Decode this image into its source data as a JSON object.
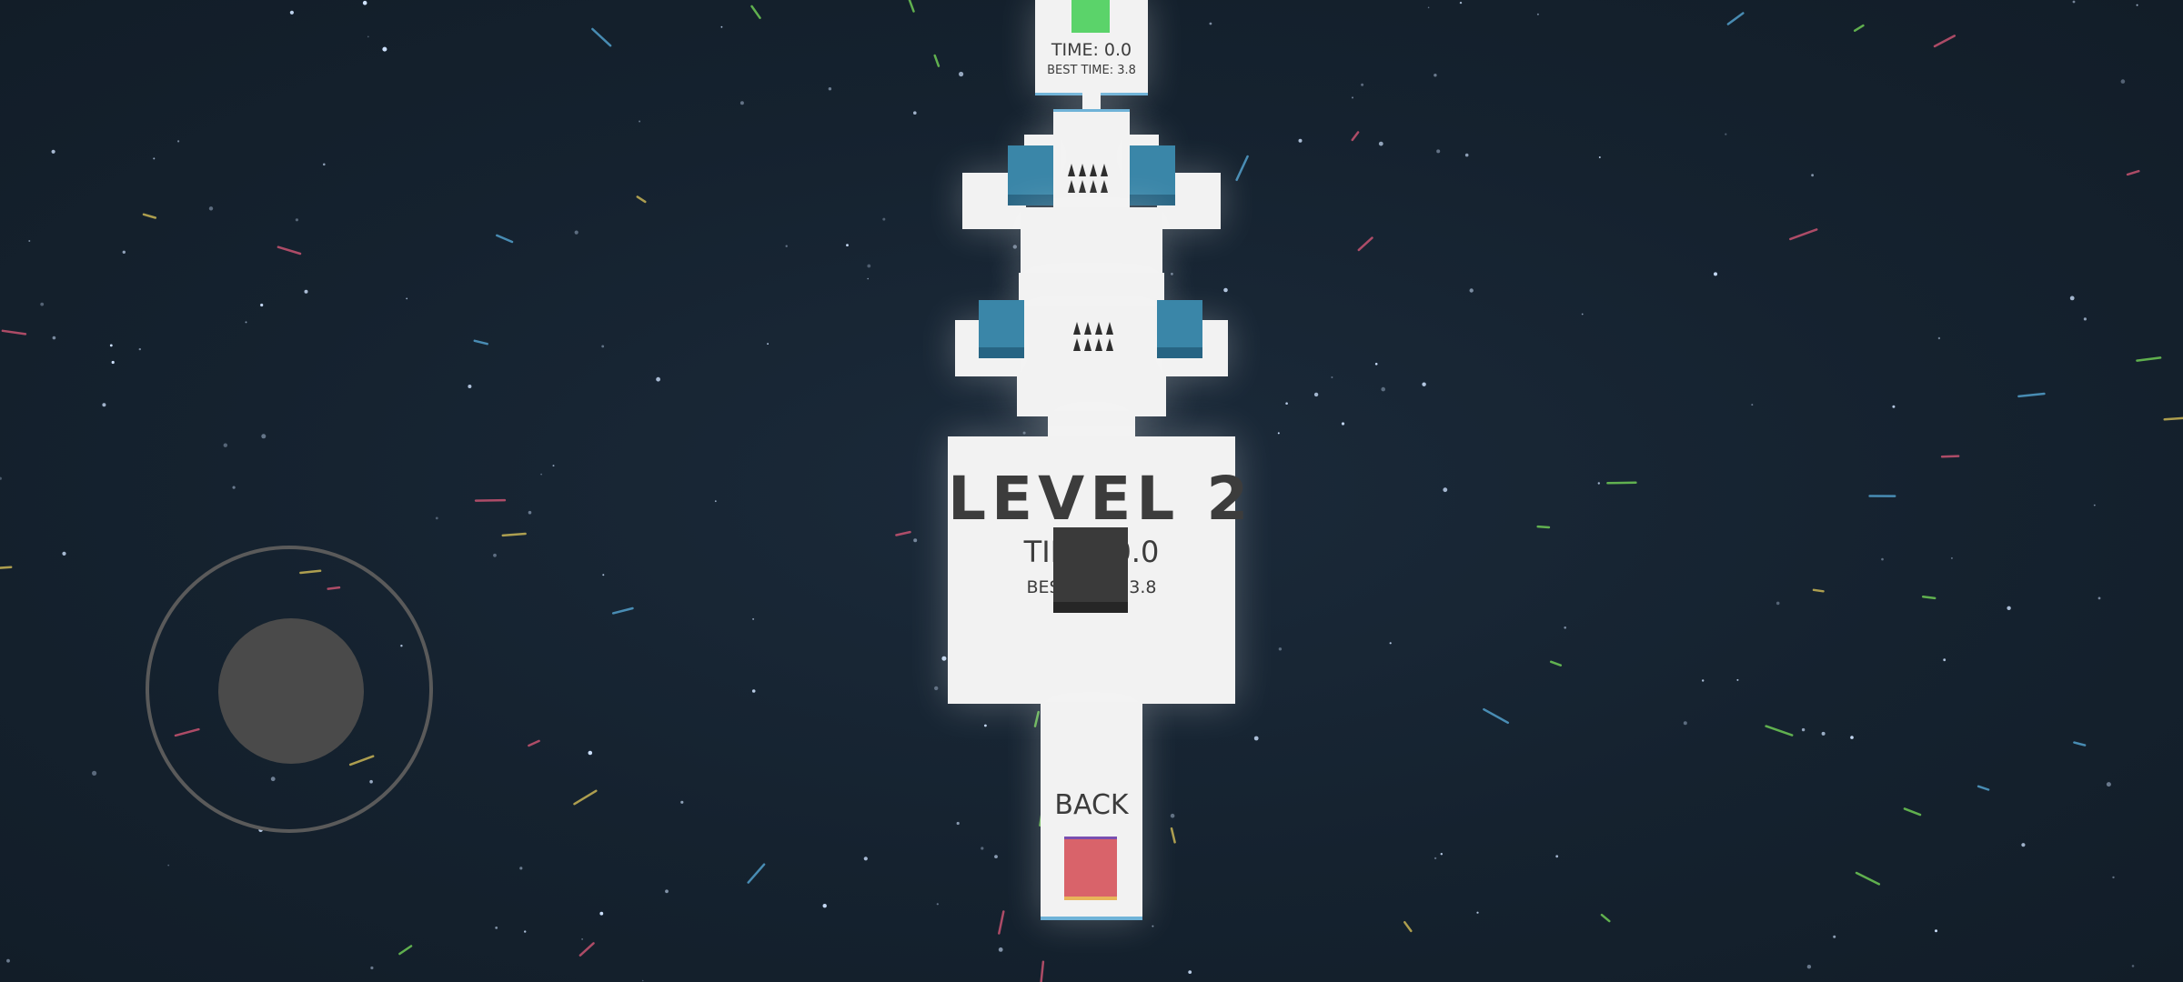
{
  "level_panel": {
    "title": "LEVEL 2",
    "time_text": "TIME: 0.0",
    "best_time_text": "BEST TIME: 3.8"
  },
  "top_panel": {
    "time_text": "TIME: 0.0",
    "best_time_text": "BEST TIME: 3.8"
  },
  "back_label": "BACK",
  "colors": {
    "background": "#15222f",
    "goal_green": "#5bd36a",
    "start_red": "#d9636a",
    "blue_cube": "#3a86a8",
    "player": "#3a3a3a",
    "tile": "#f2f2f2"
  }
}
